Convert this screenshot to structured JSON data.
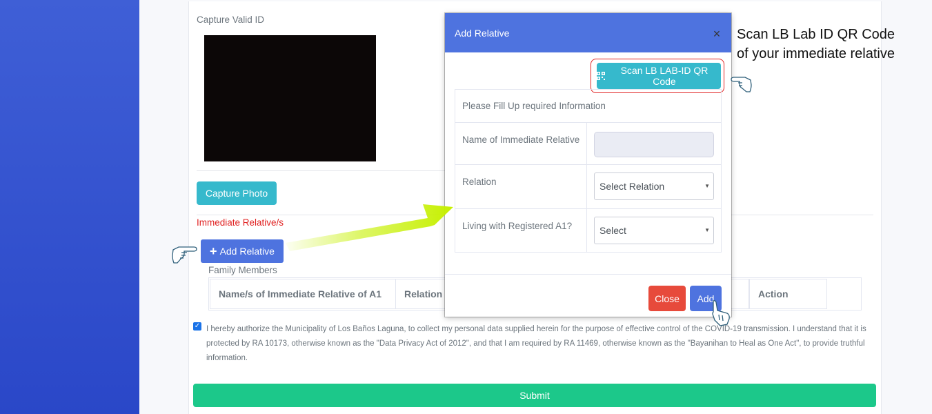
{
  "form": {
    "capture_label": "Capture Valid ID",
    "capture_button": "Capture Photo",
    "immediate_relatives_label": "Immediate Relative/s",
    "add_relative_button": "Add Relative",
    "family_members_label": "Family Members",
    "table_headers": [
      "Name/s of Immediate Relative of A1",
      "Relation",
      "Action"
    ],
    "consent_checked": true,
    "consent_text": "I hereby authorize the Municipality of Los Baños Laguna, to collect my personal data supplied herein for the purpose of effective control of the COVID-19 transmission. I understand that it is protected by RA 10173, otherwise known as the \"Data Privacy Act of 2012\", and that I am required by RA 11469, otherwise known as the \"Bayanihan to Heal as One Act\", to provide truthful information.",
    "submit_button": "Submit"
  },
  "modal": {
    "title": "Add Relative",
    "close_x": "×",
    "scan_button": "Scan LB LAB-ID QR Code",
    "table_heading": "Please Fill Up required Information",
    "name_label": "Name of Immediate Relative",
    "name_value": "",
    "relation_label": "Relation",
    "relation_selected": "Select Relation",
    "living_label": "Living with Registered A1?",
    "living_selected": "Select",
    "close_button": "Close",
    "add_button": "Add"
  },
  "annotation": {
    "callout_line1": "Scan LB Lab ID QR Code",
    "callout_line2": "of your immediate relative"
  },
  "colors": {
    "sidebar": "#2f4fd0",
    "primary": "#4e73df",
    "info": "#36b9cc",
    "success": "#1cc88a",
    "danger": "#e74a3b",
    "highlight_arrow": "#c6f000"
  }
}
